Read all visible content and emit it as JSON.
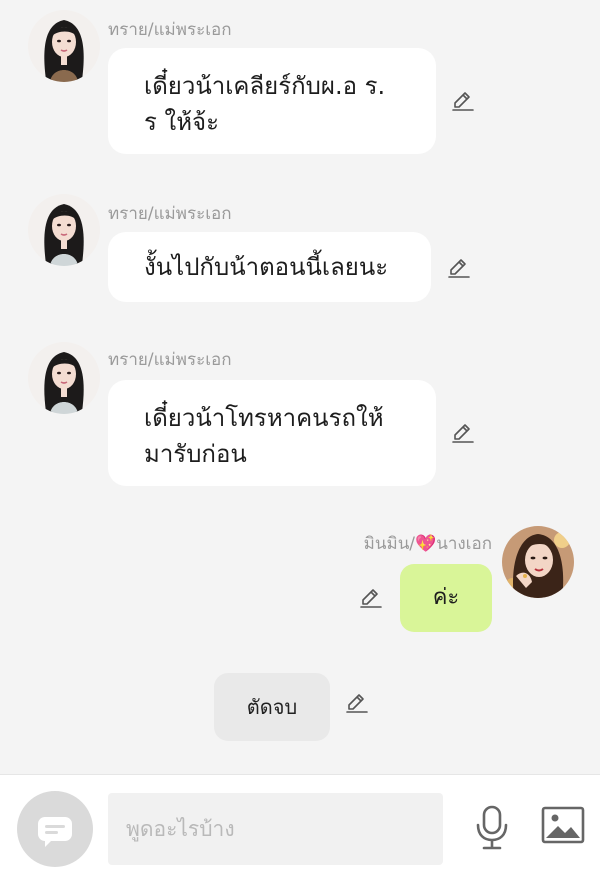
{
  "messages": [
    {
      "sender": "ทราย/แม่พระเอก",
      "lines": [
        "เดี๋ยวน้าเคลียร์กับผ.อ ร.",
        "ร ให้จ้ะ"
      ]
    },
    {
      "sender": "ทราย/แม่พระเอก",
      "lines": [
        "งั้นไปกับน้าตอนนี้เลยนะ"
      ]
    },
    {
      "sender": "ทราย/แม่พระเอก",
      "lines": [
        "เดี๋ยวน้าโทรหาคนรถให้",
        "มารับก่อน"
      ]
    }
  ],
  "my_message": {
    "sender_prefix": "มินมิน/",
    "sender_emoji": "💖",
    "sender_suffix": "นางเอก",
    "text": "ค่ะ"
  },
  "system_pill": {
    "text": "ตัดจบ"
  },
  "input_bar": {
    "placeholder": "พูดอะไรบ้าง"
  },
  "icons": {
    "edit": "pencil-edit-icon",
    "menu": "chat-menu-icon",
    "mic": "microphone-icon",
    "image": "image-gallery-icon"
  },
  "colors": {
    "background": "#f4f4f4",
    "incoming_bubble": "#ffffff",
    "outgoing_bubble": "#d9f598",
    "system_pill": "#e9e9e9",
    "sender_text": "#9a9a9a",
    "icon_gray": "#666666"
  }
}
